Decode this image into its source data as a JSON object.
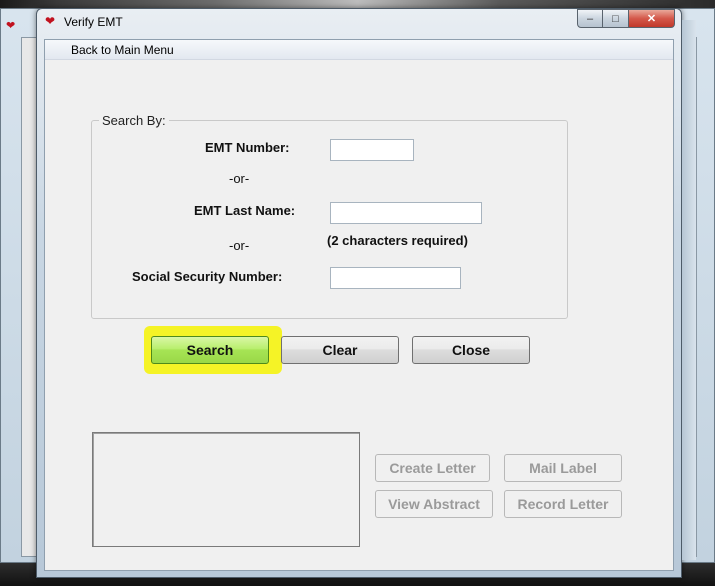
{
  "window": {
    "title": "Verify EMT",
    "controls": {
      "minimize": "–",
      "maximize": "□",
      "close": "✕"
    }
  },
  "menu": {
    "back_label": "Back to Main Menu"
  },
  "search_group": {
    "legend": "Search By:",
    "emt_number_label": "EMT Number:",
    "or_1": "-or-",
    "last_name_label": "EMT Last Name:",
    "or_2": "-or-",
    "last_name_hint": "(2 characters required)",
    "ssn_label": "Social Security Number:",
    "emt_number_value": "",
    "last_name_value": "",
    "ssn_value": ""
  },
  "actions": {
    "search": "Search",
    "clear": "Clear",
    "close": "Close"
  },
  "letters": {
    "create_letter": "Create Letter",
    "mail_label": "Mail Label",
    "view_abstract": "View Abstract",
    "record_letter": "Record Letter"
  },
  "colors": {
    "highlight": "#f4f21a",
    "search_button": "#a6e455",
    "heart": "#c1121f"
  }
}
